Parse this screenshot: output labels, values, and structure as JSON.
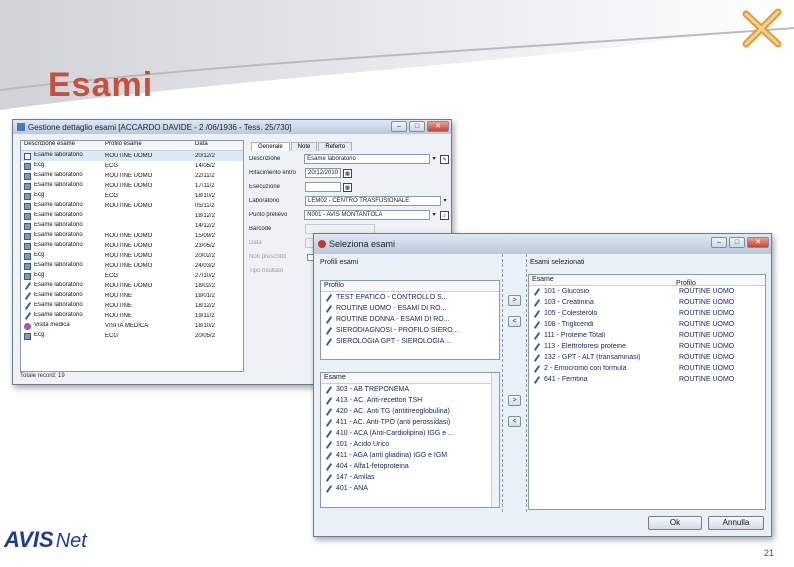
{
  "slide": {
    "title": "Esami",
    "page_number": "21",
    "brand_left": "AVIS",
    "brand_right": "Net"
  },
  "back_window": {
    "title": "Gestione dettaglio esami [ACCARDO DAVIDE - 2 /06/1936 - Tess. 25/730]",
    "grid_headers": [
      "Descrizione esame",
      "Profilo esame",
      "Data"
    ],
    "rows": [
      {
        "icon": "doc-icon",
        "desc": "Esame laboratorio",
        "profile": "ROUTINE UOMO",
        "date": "20/12/2",
        "sel": true
      },
      {
        "icon": "image-icon",
        "desc": "Ecg",
        "profile": "ECG",
        "date": "14/05/2",
        "sel": false
      },
      {
        "icon": "image-icon",
        "desc": "Esame laboratorio",
        "profile": "ROUTINE UOMO",
        "date": "22/11/2",
        "sel": false
      },
      {
        "icon": "image-icon",
        "desc": "Esame laboratorio",
        "profile": "ROUTINE UOMO",
        "date": "17/11/2",
        "sel": false
      },
      {
        "icon": "image-icon",
        "desc": "Ecg",
        "profile": "ECG",
        "date": "18/10/2",
        "sel": false
      },
      {
        "icon": "image-icon",
        "desc": "Esame laboratorio",
        "profile": "ROUTINE UOMO",
        "date": "05/11/2",
        "sel": false
      },
      {
        "icon": "image-icon",
        "desc": "Esame laboratorio",
        "profile": "",
        "date": "18/12/2",
        "sel": false
      },
      {
        "icon": "image-icon",
        "desc": "Esame laboratorio",
        "profile": "",
        "date": "14/12/2",
        "sel": false
      },
      {
        "icon": "image-icon",
        "desc": "Esame laboratorio",
        "profile": "ROUTINE UOMO",
        "date": "15/09/2",
        "sel": false
      },
      {
        "icon": "image-icon",
        "desc": "Esame laboratorio",
        "profile": "ROUTINE UOMO",
        "date": "23/05/2",
        "sel": false
      },
      {
        "icon": "image-icon",
        "desc": "Ecg",
        "profile": "ROUTINE UOMO",
        "date": "20/02/2",
        "sel": false
      },
      {
        "icon": "image-icon",
        "desc": "Esame laboratorio",
        "profile": "ROUTINE UOMO",
        "date": "24/03/2",
        "sel": false
      },
      {
        "icon": "image-icon",
        "desc": "Ecg",
        "profile": "ECG",
        "date": "27/10/2",
        "sel": false
      },
      {
        "icon": "pen-icon",
        "desc": "Esame laboratorio",
        "profile": "ROUTINE UOMO",
        "date": "18/02/2",
        "sel": false
      },
      {
        "icon": "pen-icon",
        "desc": "Esame laboratorio",
        "profile": "ROUTINE",
        "date": "18/01/2",
        "sel": false
      },
      {
        "icon": "pen-icon",
        "desc": "Esame laboratorio",
        "profile": "ROUTINE",
        "date": "18/12/2",
        "sel": false
      },
      {
        "icon": "pen-icon",
        "desc": "Esame laboratorio",
        "profile": "ROUTINE",
        "date": "19/11/2",
        "sel": false
      },
      {
        "icon": "gear-icon",
        "desc": "Visita medica",
        "profile": "VISITA MEDICA",
        "date": "18/10/2",
        "sel": false
      },
      {
        "icon": "image-icon",
        "desc": "Ecg",
        "profile": "ECG",
        "date": "20/05/2",
        "sel": false
      }
    ],
    "footer": "Totale record: 19",
    "tabs": [
      "Generale",
      "Note",
      "Referto"
    ],
    "form": {
      "descrizione_label": "Descrizione",
      "descrizione_value": "Esame laboratorio",
      "rifacimento_label": "Rifacimento entro",
      "rifacimento_value": "20/12/2010",
      "esecuzione_label": "Esecuzione",
      "esecuzione_value": "",
      "laboratorio_label": "Laboratorio",
      "laboratorio_value": "LEM02 - CENTRO TRASFUSIONALE",
      "punto_prelievo_label": "Punto prelievo",
      "punto_prelievo_value": "N001 - AVIS MONTANTOLA",
      "barcode_label": "Barcode",
      "data_label": "Data",
      "non_prescritto_label": "Non prescritto",
      "tipo_label": "Tipo risultato"
    }
  },
  "dialog": {
    "title": "Seleziona esami",
    "profili_label": "Profili esami",
    "profilo_header": "Profilo",
    "profili": [
      "TEST EPATICO - CONTROLLO S...",
      "ROUTINE UOMO - ESAMI DI RO...",
      "ROUTINE DONNA - ESAMI DI RO...",
      "SIERODIAGNOSI - PROFILO SIERO...",
      "SIEROLOGIA GPT - SIEROLOGIA ..."
    ],
    "esame_header": "Esame",
    "esami": [
      "303 - AB TREPONEMA",
      "413 - AC. Anti-recettori TSH",
      "420 - AC. Anti TG (antitireoglobulina)",
      "411 - AC. Anti-TPO (anti perossidasi)",
      "410 - ACA (Anti-Cardiolipina) IGG e ...",
      "101 - Acido Urico",
      "411 - AGA (anti gliadina) IGG e IGM",
      "404 - Alfa1-fetoproteina",
      "147 - Amilas",
      "401 - ANA"
    ],
    "selezionati_label": "Esami selezionati",
    "sel_headers": [
      "Esame",
      "Profilo"
    ],
    "selezionati": [
      {
        "esame": "101 - Glucosio",
        "profilo": "ROUTINE UOMO"
      },
      {
        "esame": "103 - Creatinina",
        "profilo": "ROUTINE UOMO"
      },
      {
        "esame": "105 - Colesterolo",
        "profilo": "ROUTINE UOMO"
      },
      {
        "esame": "108 - Trigliceridi",
        "profilo": "ROUTINE UOMO"
      },
      {
        "esame": "111 - Proteine Totali",
        "profilo": "ROUTINE UOMO"
      },
      {
        "esame": "113 - Elettroforesi proteine",
        "profilo": "ROUTINE UOMO"
      },
      {
        "esame": "132 - GPT - ALT (transaminasi)",
        "profilo": "ROUTINE UOMO"
      },
      {
        "esame": "2 - Emocromo con formula",
        "profilo": "ROUTINE UOMO"
      },
      {
        "esame": "641 - Ferritina",
        "profilo": "ROUTINE UOMO"
      }
    ],
    "ok_label": "Ok",
    "annulla_label": "Annulla",
    "add_glyph": ">",
    "remove_glyph": "<"
  }
}
